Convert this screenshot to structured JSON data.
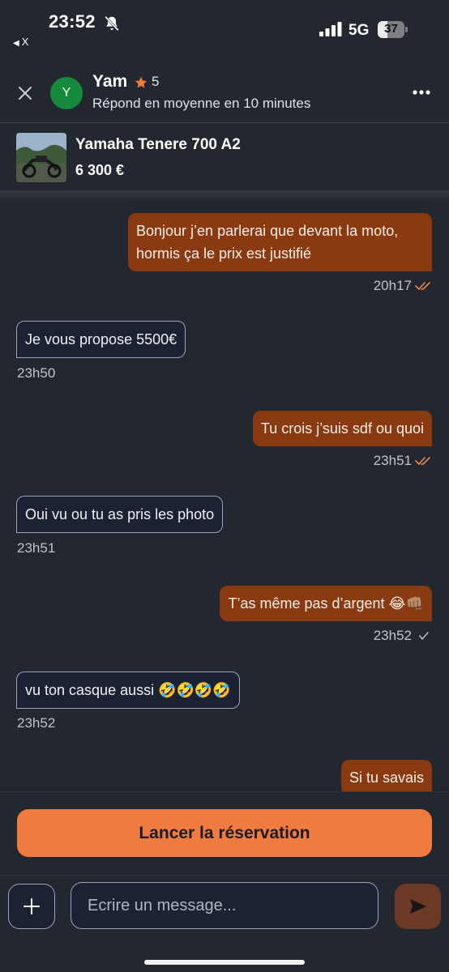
{
  "status_bar": {
    "time": "23:52",
    "back_label": "X",
    "network": "5G",
    "battery": "37",
    "battery_level": 0.37
  },
  "header": {
    "avatar_letter": "Y",
    "name": "Yam",
    "rating": "5",
    "response_time": "Répond en moyenne en 10 minutes"
  },
  "listing": {
    "title": "Yamaha Tenere 700 A2",
    "price": "6 300 €"
  },
  "messages": [
    {
      "direction": "out",
      "text": "Bonjour j’en parlerai que devant la moto, hormis ça le prix est justifié",
      "time": "20h17",
      "status": "read"
    },
    {
      "direction": "in",
      "text": "Je vous propose 5500€",
      "time": "23h50"
    },
    {
      "direction": "out",
      "text": "Tu crois j’suis sdf ou quoi",
      "time": "23h51",
      "status": "read"
    },
    {
      "direction": "in",
      "text": "Oui vu ou tu as pris les photo",
      "time": "23h51"
    },
    {
      "direction": "out",
      "text": "T’as même pas d’argent 😂👊🏽",
      "time": "23h52",
      "status": "sent"
    },
    {
      "direction": "in",
      "text": "vu ton casque aussi 🤣🤣🤣🤣",
      "time": "23h52"
    },
    {
      "direction": "out",
      "text": "Si tu savais",
      "time": ""
    }
  ],
  "bottom": {
    "reserve_label": "Lancer la réservation",
    "input_placeholder": "Ecrire un message...",
    "input_value": ""
  },
  "colors": {
    "background": "#232730",
    "outgoing_bubble": "#8a3a10",
    "incoming_bubble": "#1a2233",
    "accent": "#f07b40",
    "avatar": "#168a3d",
    "read_check": "#e9864a"
  },
  "icons": {
    "close": "close-icon",
    "star": "star-icon",
    "more": "more-icon",
    "add": "plus-icon",
    "send": "send-icon",
    "silent": "bell-slash-icon",
    "signal": "signal-icon"
  }
}
